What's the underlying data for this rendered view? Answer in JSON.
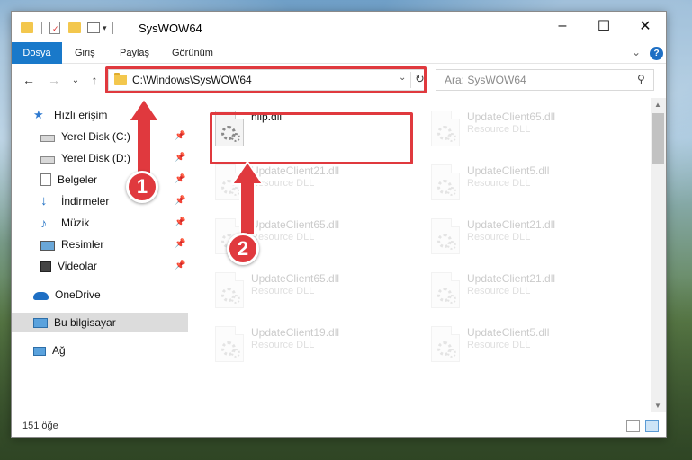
{
  "window": {
    "title": "SysWOW64",
    "controls": {
      "minimize": "–",
      "maximize": "☐",
      "close": "✕"
    }
  },
  "ribbon": {
    "tabs": [
      "Dosya",
      "Giriş",
      "Paylaş",
      "Görünüm"
    ],
    "expand_glyph": "⌄",
    "help_glyph": "?"
  },
  "navbar": {
    "back_glyph": "←",
    "forward_glyph": "→",
    "history_glyph": "⌄",
    "up_glyph": "↑",
    "address": "C:\\Windows\\SysWOW64",
    "search_placeholder": "Ara: SysWOW64"
  },
  "sidebar": {
    "items": [
      {
        "label": "Hızlı erişim",
        "icon": "star-icon",
        "pinned": false
      },
      {
        "label": "Yerel Disk (C:)",
        "icon": "drive-icon",
        "pinned": true
      },
      {
        "label": "Yerel Disk (D:)",
        "icon": "drive-icon",
        "pinned": true
      },
      {
        "label": "Belgeler",
        "icon": "documents-icon",
        "pinned": true
      },
      {
        "label": "İndirmeler",
        "icon": "download-icon",
        "pinned": true
      },
      {
        "label": "Müzik",
        "icon": "music-icon",
        "pinned": true
      },
      {
        "label": "Resimler",
        "icon": "pictures-icon",
        "pinned": true
      },
      {
        "label": "Videolar",
        "icon": "videos-icon",
        "pinned": true
      },
      {
        "label": "OneDrive",
        "icon": "cloud-icon",
        "pinned": false
      },
      {
        "label": "Bu bilgisayar",
        "icon": "computer-icon",
        "pinned": false,
        "selected": true
      },
      {
        "label": "Ağ",
        "icon": "network-icon",
        "pinned": false
      }
    ],
    "pin_glyph": "📌"
  },
  "files": [
    {
      "name": "hiip.dll",
      "desc": "",
      "ghost": false
    },
    {
      "name": "UpdateClient65.dll",
      "desc": "Resource DLL",
      "ghost": true
    },
    {
      "name": "UpdateClient21.dll",
      "desc": "Resource DLL",
      "ghost": true
    },
    {
      "name": "UpdateClient5.dll",
      "desc": "Resource DLL",
      "ghost": true
    },
    {
      "name": "UpdateClient65.dll",
      "desc": "Resource DLL",
      "ghost": true
    },
    {
      "name": "UpdateClient21.dll",
      "desc": "Resource DLL",
      "ghost": true
    },
    {
      "name": "UpdateClient65.dll",
      "desc": "Resource DLL",
      "ghost": true
    },
    {
      "name": "UpdateClient21.dll",
      "desc": "Resource DLL",
      "ghost": true
    },
    {
      "name": "UpdateClient19.dll",
      "desc": "Resource DLL",
      "ghost": true
    },
    {
      "name": "UpdateClient5.dll",
      "desc": "Resource DLL",
      "ghost": true
    }
  ],
  "status": {
    "count": "151 öğe"
  },
  "annotations": [
    {
      "number": "1",
      "color": "#e0393e"
    },
    {
      "number": "2",
      "color": "#e0393e"
    }
  ],
  "colors": {
    "accent": "#1979ca",
    "highlight": "#e0393e",
    "selected_bg": "#dcdcdc"
  }
}
